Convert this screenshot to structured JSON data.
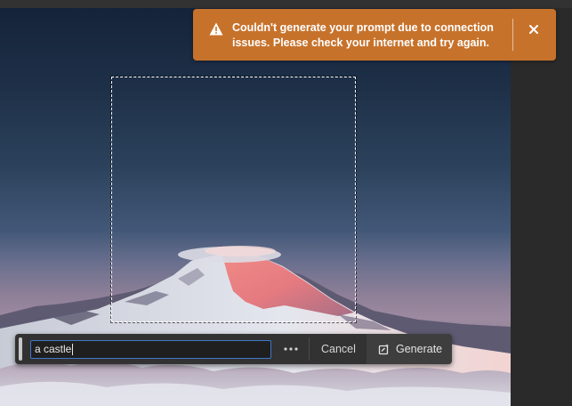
{
  "toast": {
    "message": "Couldn't generate your prompt due to connection issues. Please check your internet and try again.",
    "icon": "warning-icon",
    "close_icon": "close-icon",
    "color": "#c7722b"
  },
  "taskbar": {
    "prompt_value": "a castle",
    "more_icon": "ellipsis-icon",
    "cancel_label": "Cancel",
    "generate_label": "Generate",
    "generate_icon": "generate-icon",
    "input_border_color": "#3f77c7"
  },
  "canvas": {
    "image_subject": "snow-capped mountain at dusk",
    "selection": "rectangular-marquee"
  }
}
